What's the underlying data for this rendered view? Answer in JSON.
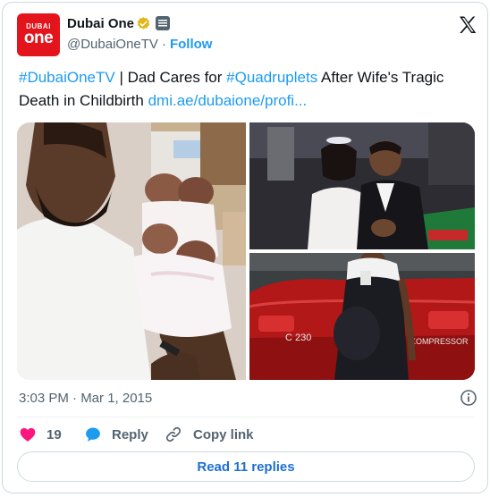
{
  "account": {
    "display_name": "Dubai One",
    "handle": "@DubaiOneTV",
    "separator": "·",
    "follow_label": "Follow",
    "logo_top": "DUBAI",
    "logo_main": "one"
  },
  "tweet": {
    "hashtag_1": "#DubaiOneTV",
    "text_1": " | Dad Cares for ",
    "hashtag_2": "#Quadruplets",
    "text_2": " After Wife's Tragic Death in Childbirth ",
    "link": "dmi.ae/dubaione/profi..."
  },
  "media": {
    "photo_3_plate": "C 230",
    "photo_3_badge": "KOMPRESSOR"
  },
  "meta": {
    "timestamp": "3:03 PM · Mar 1, 2015"
  },
  "actions": {
    "like_count": "19",
    "reply_label": "Reply",
    "copy_label": "Copy link"
  },
  "replies_button": "Read 11 replies",
  "colors": {
    "accent": "#1d9bf0",
    "like": "#f91880",
    "brand": "#e3141b",
    "verified": "#e2b719"
  }
}
